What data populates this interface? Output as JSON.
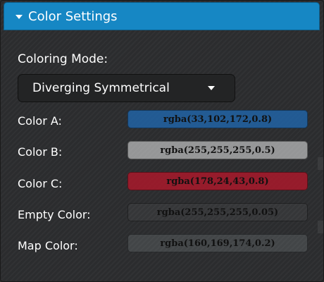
{
  "panel": {
    "title": "Color Settings",
    "collapse_icon": "caret-down-icon"
  },
  "mode": {
    "label": "Coloring Mode:",
    "value": "Diverging Symmetrical",
    "arrow_icon": "caret-down-icon"
  },
  "colors": [
    {
      "label": "Color A:",
      "value": "rgba(33,102,172,0.8)",
      "swatch": "rgba(33,102,172,0.8)"
    },
    {
      "label": "Color B:",
      "value": "rgba(255,255,255,0.5)",
      "swatch": "rgba(255,255,255,0.5)"
    },
    {
      "label": "Color C:",
      "value": "rgba(178,24,43,0.8)",
      "swatch": "rgba(178,24,43,0.8)"
    },
    {
      "label": "Empty Color:",
      "value": "rgba(255,255,255,0.05)",
      "swatch": "rgba(255,255,255,0.05)"
    },
    {
      "label": "Map Color:",
      "value": "rgba(160,169,174,0.2)",
      "swatch": "rgba(160,169,174,0.2)"
    }
  ],
  "style": {
    "header_color": "#1687c4",
    "panel_background": "#2c2d2f"
  }
}
